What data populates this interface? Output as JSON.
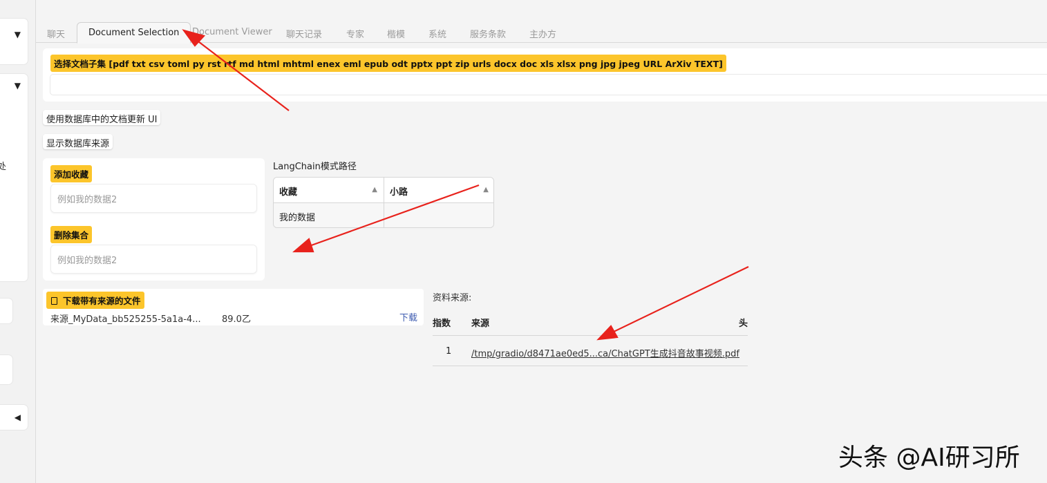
{
  "sidebar": {
    "collapse_icon": "caret-down-icon",
    "truncated_text": "处",
    "expand_left_icon": "caret-left-icon"
  },
  "tabs": [
    {
      "label": "聊天"
    },
    {
      "label": "Document Selection",
      "active": true
    },
    {
      "label": "Document Viewer"
    },
    {
      "label": "聊天记录"
    },
    {
      "label": "专家"
    },
    {
      "label": "楷模"
    },
    {
      "label": "系统"
    },
    {
      "label": "服务条款"
    },
    {
      "label": "主办方"
    }
  ],
  "subset": {
    "label": "选择文档子集 [pdf txt csv toml py rst rtf md html mhtml enex eml epub odt pptx ppt zip urls docx doc xls xlsx png jpg jpeg URL ArXiv TEXT]",
    "value": ""
  },
  "buttons": {
    "update_ui": "使用数据库中的文档更新 UI",
    "show_sources": "显示数据库来源"
  },
  "collections": {
    "add_label": "添加收藏",
    "add_placeholder": "例如我的数据2",
    "delete_label": "删除集合",
    "delete_placeholder": "例如我的数据2"
  },
  "langchain": {
    "title": "LangChain模式路径",
    "headers": [
      "收藏",
      "小路"
    ],
    "rows": [
      [
        "我的数据",
        ""
      ]
    ]
  },
  "download": {
    "label": "下载带有来源的文件",
    "file_name": "来源_MyData_bb525255-5a1a-4...",
    "file_size": "89.0乙",
    "link": "下载"
  },
  "sources": {
    "title": "资料来源:",
    "headers": [
      "指数",
      "来源",
      "头"
    ],
    "rows": [
      {
        "index": "1",
        "source": "/tmp/gradio/d8471ae0ed5...ca/ChatGPT生成抖音故事视频.pdf"
      }
    ]
  },
  "watermark": "头条 @AI研习所",
  "colors": {
    "badge": "#fcc52b",
    "link": "#3d5bb0",
    "annotation_arrow": "#e8221c"
  }
}
